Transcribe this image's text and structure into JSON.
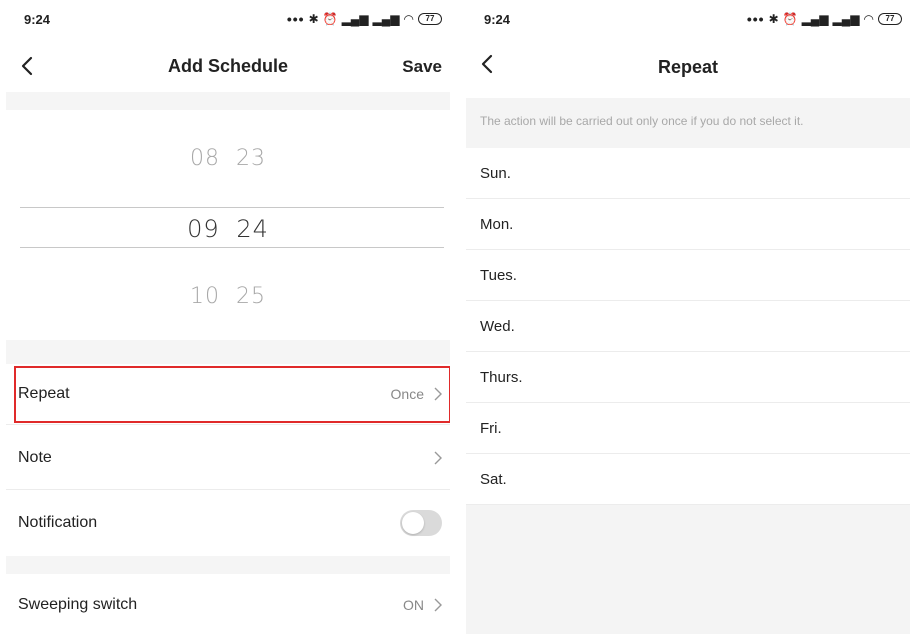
{
  "status_bar": {
    "time": "9:24",
    "battery": "77"
  },
  "schedule_screen": {
    "title": "Add Schedule",
    "save_label": "Save",
    "picker": {
      "prev": {
        "hour": "08",
        "minute": "23"
      },
      "selected": {
        "hour": "09",
        "minute": "24"
      },
      "next": {
        "hour": "10",
        "minute": "25"
      }
    },
    "settings": {
      "repeat": {
        "label": "Repeat",
        "value": "Once"
      },
      "note": {
        "label": "Note"
      },
      "notification": {
        "label": "Notification",
        "enabled": false
      },
      "sweeping_switch": {
        "label": "Sweeping switch",
        "value": "ON"
      }
    },
    "highlight_color": "#e02a2a"
  },
  "repeat_screen": {
    "title": "Repeat",
    "info_text": "The action will be carried out only once if you do not select it.",
    "days": [
      "Sun.",
      "Mon.",
      "Tues.",
      "Wed.",
      "Thurs.",
      "Fri.",
      "Sat."
    ]
  }
}
